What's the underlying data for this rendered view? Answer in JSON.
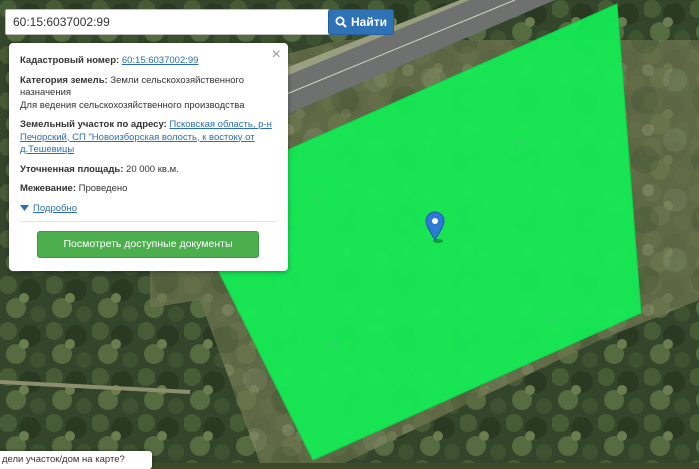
{
  "search": {
    "value": "60:15:6037002:99",
    "button_label": "Найти"
  },
  "parcel": {
    "cadastral_label": "Кадастровый номер:",
    "cadastral_number": "60:15:6037002:99",
    "category_label": "Категория земель:",
    "category_value": "Земли сельскохозяйственного назначения",
    "usage": "Для ведения сельскохозяйственного производства",
    "address_label": "Земельный участок по адресу:",
    "address_value": "Псковская область, р-н Печорский, СП \"Новоизборская волость, к востоку от д.Тешевицы",
    "area_label": "Уточненная площадь:",
    "area_value": "20 000 кв.м.",
    "survey_label": "Межевание:",
    "survey_value": "Проведено",
    "more_label": "Подробно",
    "docs_button": "Посмотреть доступные документы",
    "close_symbol": "×"
  },
  "tooltip": {
    "text": "дели участок/дом на карте?"
  },
  "icons": {
    "search": "search-icon",
    "close": "close-icon",
    "marker": "map-marker-icon",
    "expand": "triangle-down-icon"
  },
  "colors": {
    "parcel_fill": "#11ee55",
    "search_button": "#2f73b7",
    "docs_button": "#4cae4c",
    "link": "#2a6fb3",
    "marker": "#2e7bd6"
  }
}
